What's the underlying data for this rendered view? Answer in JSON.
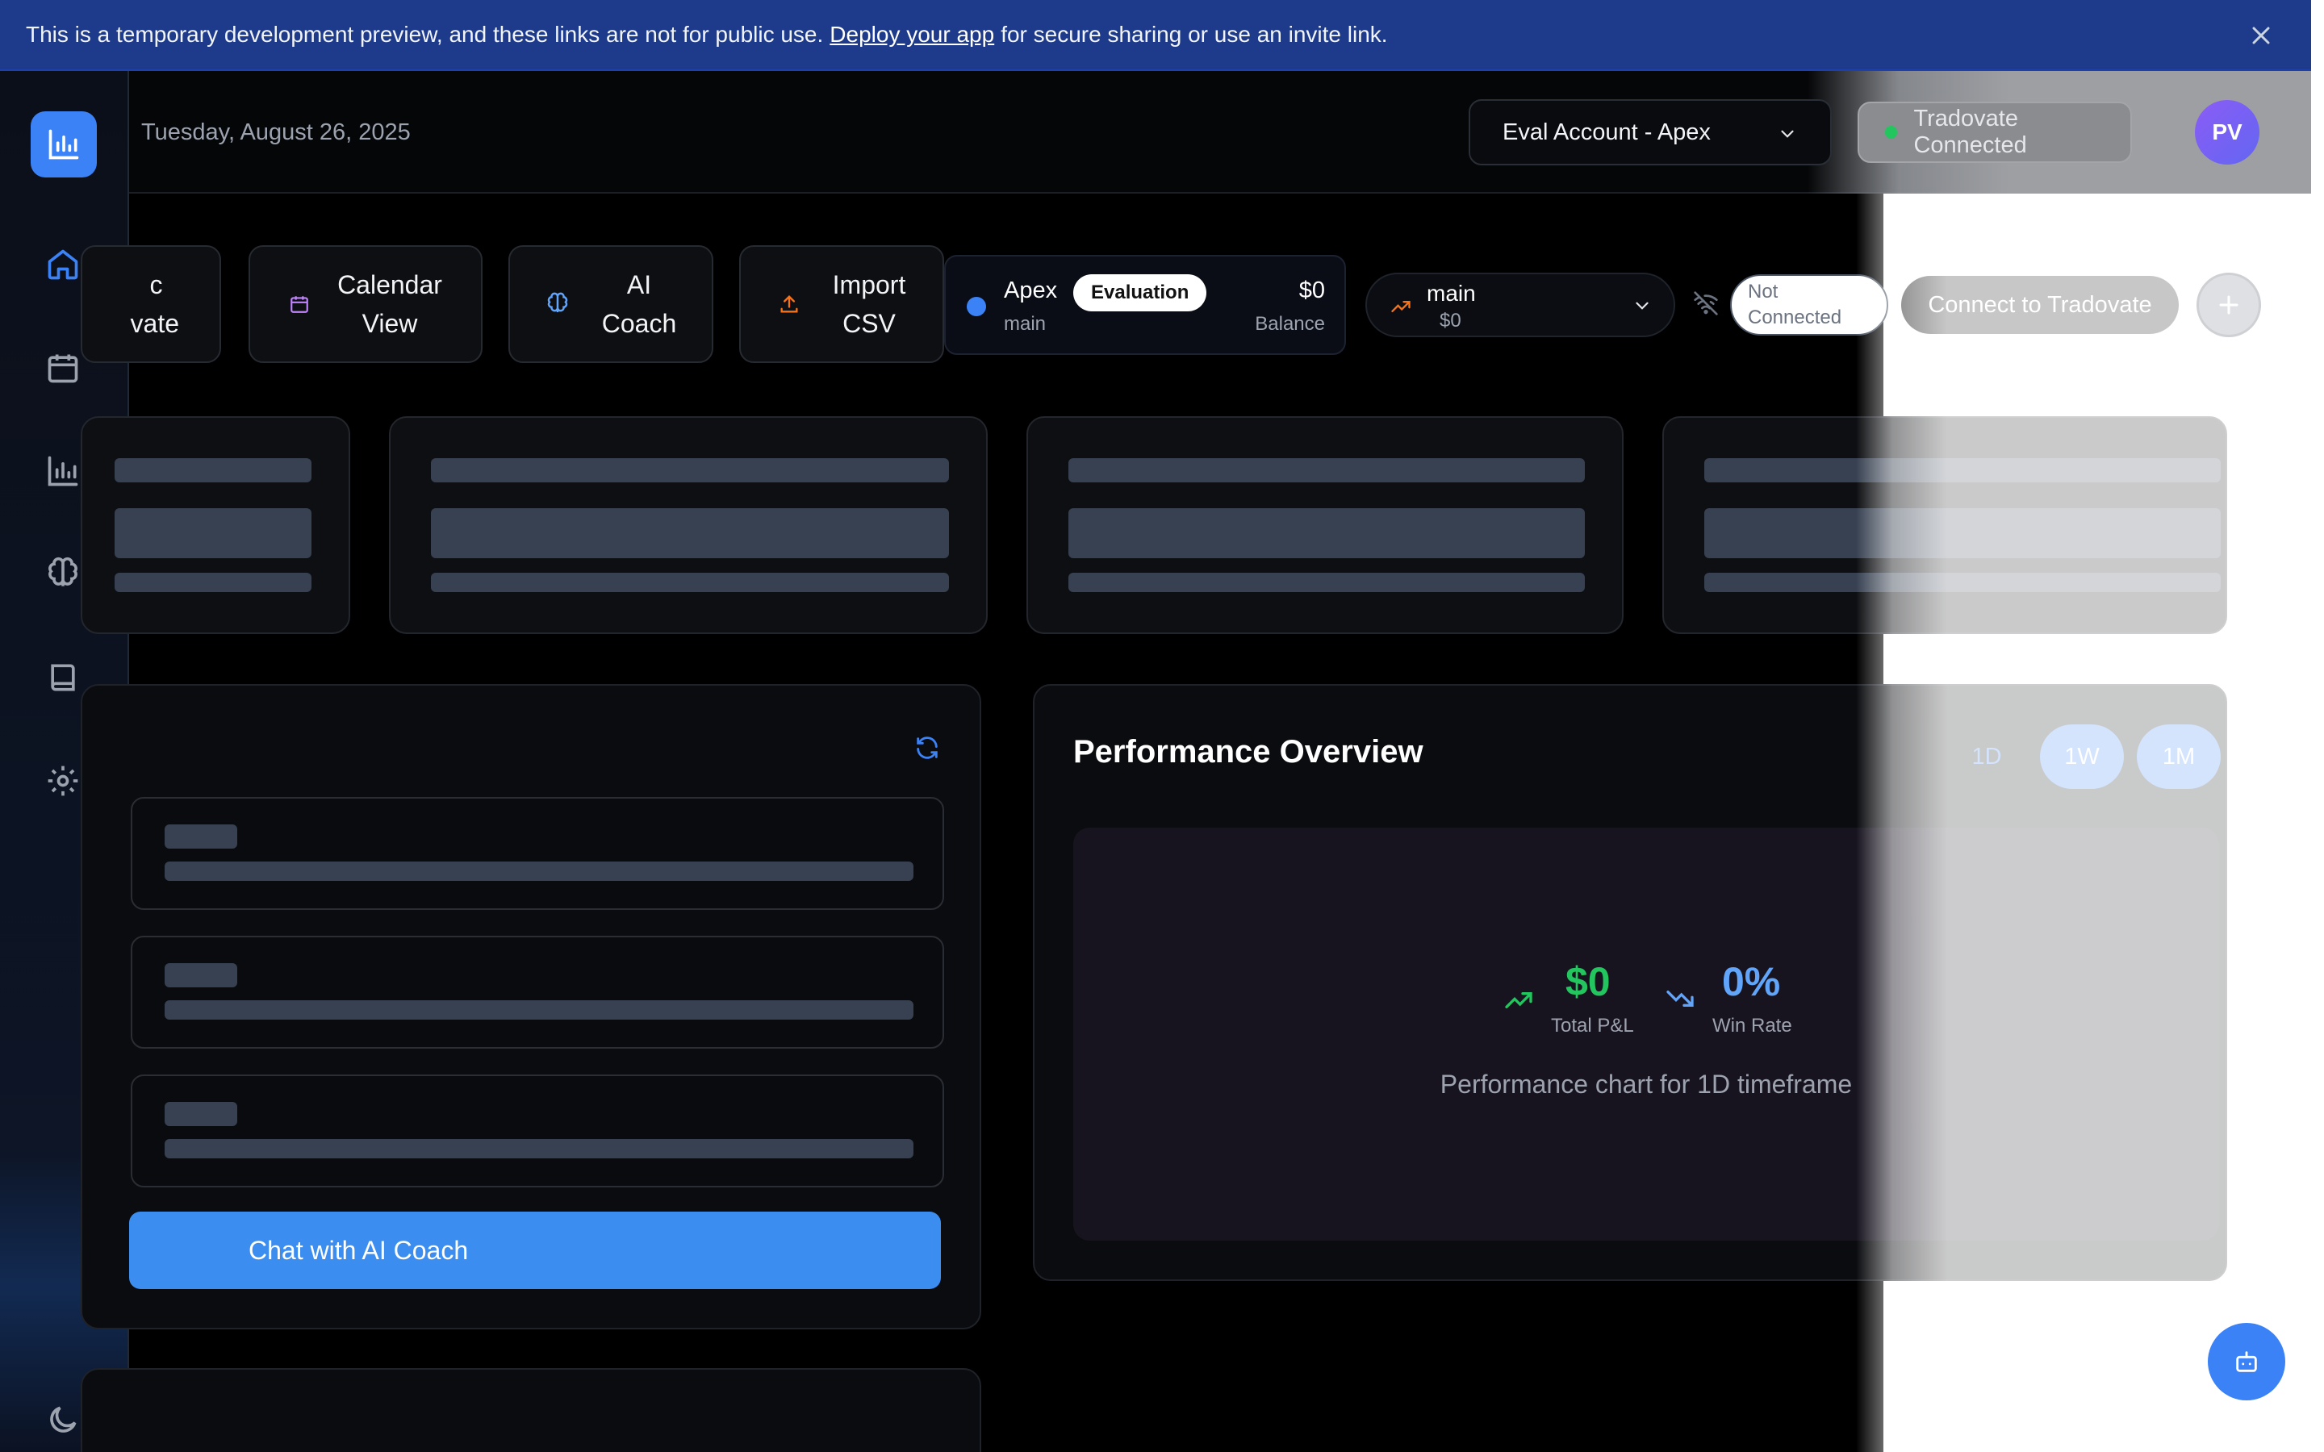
{
  "banner": {
    "text_before": "This is a temporary development preview, and these links are not for public use.",
    "link_text": "Deploy your app",
    "text_after": "for secure sharing or use an invite link."
  },
  "header": {
    "date": "Tuesday, August 26, 2025",
    "account_select": "Eval Account - Apex",
    "connection_status": "Tradovate Connected",
    "avatar_initials": "PV"
  },
  "sidebar": {
    "items": [
      {
        "icon": "home-icon"
      },
      {
        "icon": "calendar-icon"
      },
      {
        "icon": "bar-chart-icon"
      },
      {
        "icon": "brain-icon"
      },
      {
        "icon": "book-icon"
      },
      {
        "icon": "gear-icon"
      }
    ]
  },
  "quick_actions": [
    {
      "line1": "c",
      "line2": "vate"
    },
    {
      "line1": "Calendar",
      "line2": "View"
    },
    {
      "line1": "AI",
      "line2": "Coach"
    },
    {
      "line1": "Import",
      "line2": "CSV"
    }
  ],
  "account_card": {
    "name": "Apex",
    "badge": "Evaluation",
    "sub": "main",
    "balance": "$0",
    "balance_label": "Balance"
  },
  "branch_select": {
    "name": "main",
    "value": "$0"
  },
  "tradovate": {
    "status_line1": "Not",
    "status_line2": "Connected",
    "connect_label": "Connect to Tradovate"
  },
  "coach": {
    "chat_button": "Chat with AI Coach"
  },
  "performance": {
    "title": "Performance Overview",
    "timeframes": [
      "1D",
      "1W",
      "1M"
    ],
    "active_timeframe": "1D",
    "total_pnl": "$0",
    "total_pnl_label": "Total P&L",
    "win_rate": "0%",
    "win_rate_label": "Win Rate",
    "caption": "Performance chart for 1D timeframe"
  },
  "colors": {
    "accent": "#3b82f6",
    "positive": "#22c55e",
    "banner": "#1e3a8a"
  }
}
